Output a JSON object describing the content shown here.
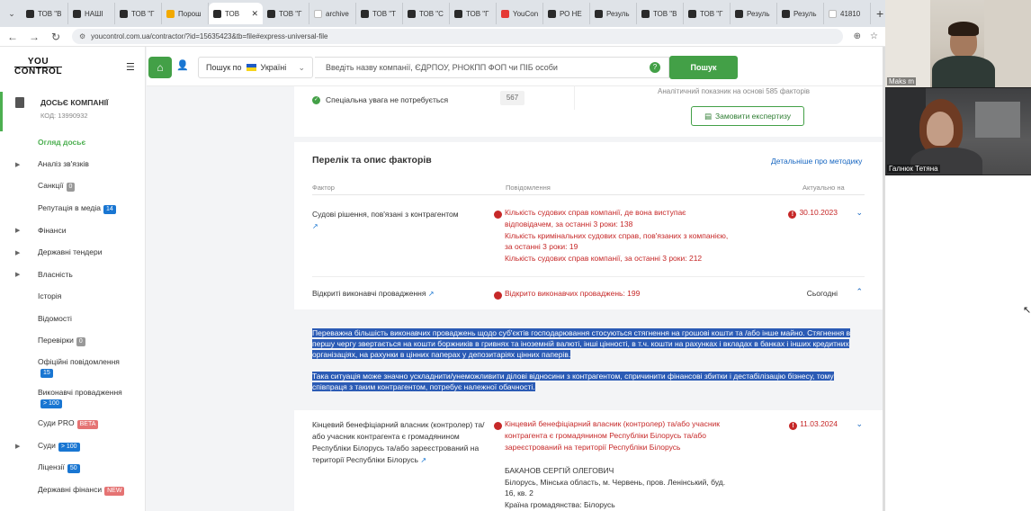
{
  "browser": {
    "tabs": [
      "ТОВ \"В",
      "НАШІ",
      "ТОВ \"Г",
      "Порош",
      "ТОВ",
      "ТОВ \"Г",
      "archive",
      "ТОВ \"Т",
      "ТОВ \"С",
      "ТОВ \"Г",
      "YouCon",
      "РО НЕ",
      "Резуль",
      "ТОВ \"В",
      "ТОВ \"Г",
      "Резуль",
      "Резуль",
      "41810"
    ],
    "active_tab_index": 4,
    "url": "youcontrol.com.ua/contractor/?id=15635423&tb=file#express-universal-file"
  },
  "app": {
    "logo_top": "YOU",
    "logo_bottom": "CONTROL",
    "dossier": {
      "title": "ДОСЬЄ КОМПАНІЇ",
      "code": "КОД: 13990932"
    },
    "menu": [
      {
        "label": "Огляд досьє",
        "active": true,
        "arrow": false,
        "badge": ""
      },
      {
        "label": "Аналіз зв'язків",
        "arrow": true,
        "badge": ""
      },
      {
        "label": "Санкції",
        "arrow": false,
        "badge": "0"
      },
      {
        "label": "Репутація в медіа",
        "arrow": false,
        "badge": "14"
      },
      {
        "label": "Фінанси",
        "arrow": true,
        "badge": ""
      },
      {
        "label": "Державні тендери",
        "arrow": true,
        "badge": ""
      },
      {
        "label": "Власність",
        "arrow": true,
        "badge": ""
      },
      {
        "label": "Історія",
        "arrow": false,
        "badge": ""
      },
      {
        "label": "Відомості",
        "arrow": false,
        "badge": ""
      },
      {
        "label": "Перевірки",
        "arrow": false,
        "badge": "0"
      },
      {
        "label": "Офіційні повідомлення",
        "arrow": false,
        "badge": "15"
      },
      {
        "label": "Виконавчі провадження",
        "arrow": false,
        "badge": "> 100"
      },
      {
        "label": "Суди PRO",
        "arrow": false,
        "badge": "BETA"
      },
      {
        "label": "Суди",
        "arrow": true,
        "badge": "> 100"
      },
      {
        "label": "Ліцензії",
        "arrow": false,
        "badge": "50"
      },
      {
        "label": "Державні фінанси",
        "arrow": false,
        "badge": "NEW"
      }
    ],
    "search": {
      "by_label": "Пошук по",
      "country": "Україні",
      "placeholder": "Введіть назву компанії, ЄДРПОУ, РНОКПП ФОП чи ПІБ особи",
      "button": "Пошук"
    },
    "status": {
      "label": "Спеціальна увага не потребується",
      "score": "567",
      "analytic": "Аналітичний показник на основі 585 факторів",
      "order_button": "Замовити експертизу"
    },
    "factors": {
      "title": "Перелік та опис факторів",
      "method_link": "Детальніше про методику",
      "headers": {
        "factor": "Фактор",
        "message": "Повідомлення",
        "date": "Актуально на"
      },
      "rows": [
        {
          "name": "Судові рішення, пов'язані з контрагентом",
          "messages": [
            "Кількість судових справ компанії, де вона виступає відповідачем, за останні 3 роки: 138",
            "Кількість кримінальних судових справ, пов'язаних з компанією, за останні 3 роки: 19",
            "Кількість судових справ компанії, за останні 3 роки: 212"
          ],
          "date": "30.10.2023"
        },
        {
          "name": "Відкриті виконавчі провадження",
          "messages": [
            "Відкрито виконавчих проваджень: 199"
          ],
          "date": "Сьогодні"
        },
        {
          "name": "Кінцевий бенефіціарний власник (контролер) та/або учасник контрагента є громадянином Республіки Білорусь та/або зареєстрований на території Республіки Білорусь",
          "messages": [
            "Кінцевий бенефіціарний власник (контролер) та/або учасник контрагента є громадянином Республіки Білорусь та/або зареєстрований на території Республіки Білорусь"
          ],
          "date": "11.03.2024",
          "person": "БАКАНОВ СЕРГІЙ ОЛЕГОВИЧ",
          "address": "Білорусь, Мінська область, м. Червень, пров. Ленінський, буд. 16, кв. 2",
          "citizenship": "Країна громадянства: Білорусь"
        }
      ],
      "expanded_text_1": "Переважна більшість виконавчих проваджень щодо суб'єктів господарювання стосуються стягнення на грошові кошти та /або інше майно. Стягнення в першу чергу звертається на кошти боржників в гривнях та іноземній валюті, інші цінності, в т.ч. кошти на рахунках і вкладах в банках і інших кредитних організаціях, на рахунки в цінних паперах у депозитаріях цінних паперів.",
      "expanded_text_2": "Така ситуація може значно ускладнити/унеможливити ділові відносини з контрагентом, спричинити фінансові збитки і дестабілізацію бізнесу, тому співпраця з таким контрагентом, потребує належної обачності."
    }
  },
  "video": {
    "participant_1": "Maks m",
    "participant_2": "Галнюк Тетяна"
  },
  "colors": {
    "accent": "#43a047",
    "danger": "#c62828",
    "link": "#1565c0",
    "selection": "#2b5bb5"
  }
}
